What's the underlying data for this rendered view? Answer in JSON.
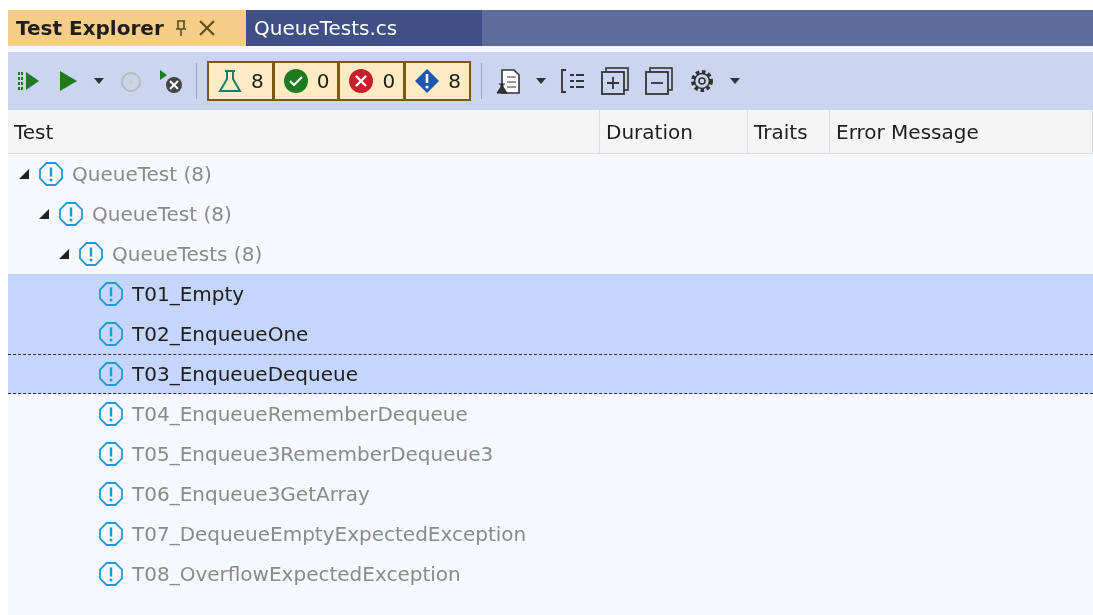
{
  "tabs": [
    {
      "label": "Test Explorer",
      "selected": true
    },
    {
      "label": "QueueTests.cs",
      "selected": false
    }
  ],
  "toolbar": {
    "counters": [
      {
        "kind": "total",
        "count": "8"
      },
      {
        "kind": "passed",
        "count": "0"
      },
      {
        "kind": "failed",
        "count": "0"
      },
      {
        "kind": "not_run",
        "count": "8"
      }
    ]
  },
  "table": {
    "columns": [
      "Test",
      "Duration",
      "Traits",
      "Error Message"
    ]
  },
  "tree": [
    {
      "label": "QueueTest (8)",
      "expanded": true,
      "selected": false,
      "children": [
        {
          "label": "QueueTest (8)",
          "expanded": true,
          "selected": false,
          "children": [
            {
              "label": "QueueTests (8)",
              "expanded": true,
              "selected": false,
              "children": [
                {
                  "label": "T01_Empty",
                  "selected": true
                },
                {
                  "label": "T02_EnqueueOne",
                  "selected": true
                },
                {
                  "label": "T03_EnqueueDequeue",
                  "selected": true,
                  "focused": true
                },
                {
                  "label": "T04_EnqueueRememberDequeue",
                  "selected": false
                },
                {
                  "label": "T05_Enqueue3RememberDequeue3",
                  "selected": false
                },
                {
                  "label": "T06_Enqueue3GetArray",
                  "selected": false
                },
                {
                  "label": "T07_DequeueEmptyExpectedException",
                  "selected": false
                },
                {
                  "label": "T08_OverflowExpectedException",
                  "selected": false
                }
              ]
            }
          ]
        }
      ]
    }
  ]
}
